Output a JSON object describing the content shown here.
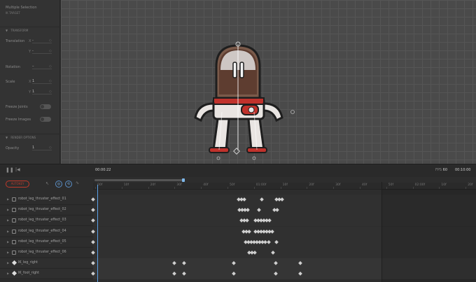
{
  "properties": {
    "title": "Multiple Selection",
    "subtitle": "IK TARGET",
    "transform_label": "TRANSFORM",
    "translation_label": "Translation",
    "translation_x": "-",
    "translation_y": "-",
    "rotation_label": "Rotation",
    "rotation_value": "–",
    "scale_label": "Scale",
    "scale_x": "1",
    "scale_y": "1",
    "freeze_joints_label": "Freeze Joints",
    "freeze_images_label": "Freeze Images",
    "render_options_label": "RENDER OPTIONS",
    "opacity_label": "Opacity",
    "opacity_value": "1",
    "axis_x": "X",
    "axis_y": "Y"
  },
  "timeline": {
    "current_time": "00:00:22",
    "fps_label": "FPS",
    "fps_value": "60",
    "end_time": "00:10:00",
    "autokey_label": "AUTOKEY",
    "ruler_ticks": [
      "00f",
      "10f",
      "20f",
      "30f",
      "40f",
      "50f",
      "01:00f",
      "10f",
      "20f",
      "30f",
      "40f",
      "50f",
      "02:00f",
      "10f",
      "20f"
    ],
    "tracks": [
      {
        "name": "robot_leg_thruster_effect_01",
        "kind": "layer",
        "keys": [
          0,
          208,
          212,
          216,
          241,
          262,
          266,
          270
        ]
      },
      {
        "name": "robot_leg_thruster_effect_02",
        "kind": "layer",
        "keys": [
          0,
          209,
          213,
          217,
          221,
          237,
          259,
          263
        ]
      },
      {
        "name": "robot_leg_thruster_effect_03",
        "kind": "layer",
        "keys": [
          0,
          212,
          216,
          220,
          232,
          236,
          240,
          244,
          248,
          252
        ]
      },
      {
        "name": "robot_leg_thruster_effect_04",
        "kind": "layer",
        "keys": [
          0,
          215,
          219,
          223,
          232,
          236,
          240,
          244,
          248,
          252,
          256
        ]
      },
      {
        "name": "robot_leg_thruster_effect_05",
        "kind": "layer",
        "keys": [
          0,
          218,
          222,
          226,
          230,
          234,
          238,
          242,
          246,
          251,
          262
        ]
      },
      {
        "name": "robot_leg_thruster_effect_06",
        "kind": "layer",
        "keys": [
          0,
          223,
          227,
          231,
          257
        ]
      },
      {
        "name": "IK_leg_right",
        "kind": "ik",
        "keys": [
          0,
          116,
          130,
          201,
          261,
          296
        ]
      },
      {
        "name": "IK_foot_right",
        "kind": "ik",
        "keys": [
          0,
          116,
          130,
          201,
          261,
          296
        ]
      }
    ]
  },
  "colors": {
    "accent": "#5aa0e6",
    "autokey": "#c0392b"
  }
}
